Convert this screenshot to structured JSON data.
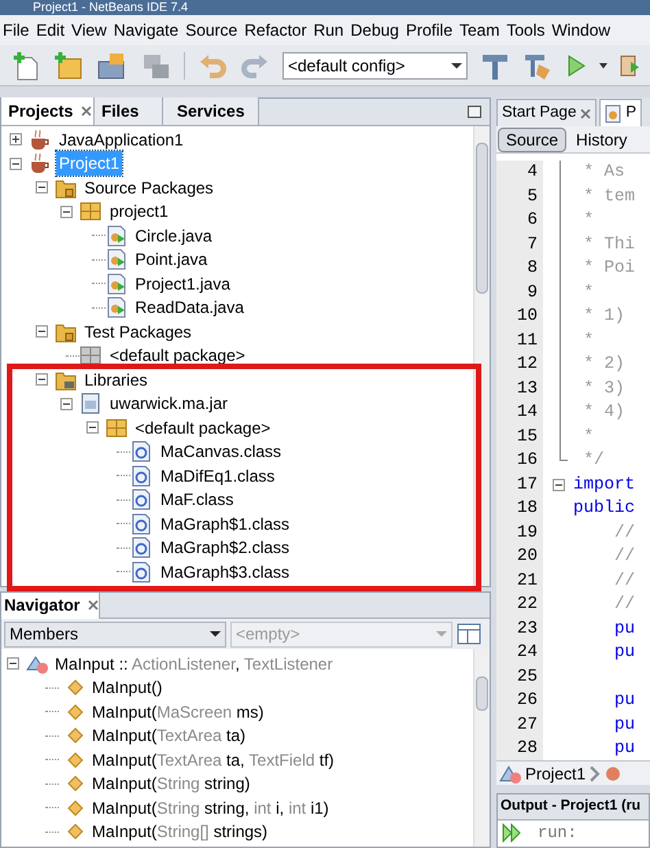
{
  "window": {
    "title": "Project1 - NetBeans IDE 7.4"
  },
  "menu": [
    "File",
    "Edit",
    "View",
    "Navigate",
    "Source",
    "Refactor",
    "Run",
    "Debug",
    "Profile",
    "Team",
    "Tools",
    "Window"
  ],
  "toolbar": {
    "config": "<default config>"
  },
  "projects_panel": {
    "tabs": [
      {
        "label": "Projects",
        "selected": true,
        "closable": true
      },
      {
        "label": "Files",
        "selected": false,
        "closable": false
      },
      {
        "label": "Services",
        "selected": false,
        "closable": false
      }
    ],
    "tree": [
      {
        "label": "JavaApplication1",
        "kind": "project",
        "expanded": false,
        "selected": false
      },
      {
        "label": "Project1",
        "kind": "project",
        "expanded": true,
        "selected": true,
        "children": [
          {
            "label": "Source Packages",
            "kind": "source-folder",
            "expanded": true,
            "selected": false,
            "children": [
              {
                "label": "project1",
                "kind": "package",
                "expanded": true,
                "selected": false,
                "children": [
                  {
                    "label": "Circle.java",
                    "kind": "java",
                    "selected": false
                  },
                  {
                    "label": "Point.java",
                    "kind": "java",
                    "selected": false
                  },
                  {
                    "label": "Project1.java",
                    "kind": "java",
                    "selected": false
                  },
                  {
                    "label": "ReadData.java",
                    "kind": "java",
                    "selected": false
                  }
                ]
              }
            ]
          },
          {
            "label": "Test Packages",
            "kind": "source-folder",
            "expanded": true,
            "selected": false,
            "children": [
              {
                "label": "<default package>",
                "kind": "empty-package",
                "selected": false
              }
            ]
          },
          {
            "label": "Libraries",
            "kind": "libraries",
            "expanded": true,
            "selected": false,
            "children": [
              {
                "label": "uwarwick.ma.jar",
                "kind": "jar",
                "expanded": true,
                "selected": false,
                "children": [
                  {
                    "label": "<default package>",
                    "kind": "package",
                    "expanded": true,
                    "selected": false,
                    "children": [
                      {
                        "label": "MaCanvas.class",
                        "kind": "class",
                        "selected": false
                      },
                      {
                        "label": "MaDifEq1.class",
                        "kind": "class",
                        "selected": false
                      },
                      {
                        "label": "MaF.class",
                        "kind": "class",
                        "selected": false
                      },
                      {
                        "label": "MaGraph$1.class",
                        "kind": "class",
                        "selected": false
                      },
                      {
                        "label": "MaGraph$2.class",
                        "kind": "class",
                        "selected": false
                      },
                      {
                        "label": "MaGraph$3.class",
                        "kind": "class",
                        "selected": false
                      }
                    ]
                  }
                ]
              }
            ]
          }
        ]
      }
    ]
  },
  "navigator": {
    "title": "Navigator",
    "filter": "Members",
    "secondary": "<empty>",
    "root": {
      "parts": [
        {
          "text": "MaInput :: ",
          "kind": "name"
        },
        {
          "text": "ActionListener",
          "kind": "type"
        },
        {
          "text": ", ",
          "kind": "name"
        },
        {
          "text": "TextListener",
          "kind": "type"
        }
      ],
      "expanded": true
    },
    "members": [
      {
        "parts": [
          {
            "text": "MaInput()",
            "kind": "name"
          }
        ]
      },
      {
        "parts": [
          {
            "text": "MaInput(",
            "kind": "name"
          },
          {
            "text": "MaScreen",
            "kind": "type"
          },
          {
            "text": " ms)",
            "kind": "name"
          }
        ]
      },
      {
        "parts": [
          {
            "text": "MaInput(",
            "kind": "name"
          },
          {
            "text": "TextArea",
            "kind": "type"
          },
          {
            "text": " ta)",
            "kind": "name"
          }
        ]
      },
      {
        "parts": [
          {
            "text": "MaInput(",
            "kind": "name"
          },
          {
            "text": "TextArea",
            "kind": "type"
          },
          {
            "text": " ta, ",
            "kind": "name"
          },
          {
            "text": "TextField",
            "kind": "type"
          },
          {
            "text": " tf)",
            "kind": "name"
          }
        ]
      },
      {
        "parts": [
          {
            "text": "MaInput(",
            "kind": "name"
          },
          {
            "text": "String",
            "kind": "type"
          },
          {
            "text": " string)",
            "kind": "name"
          }
        ]
      },
      {
        "parts": [
          {
            "text": "MaInput(",
            "kind": "name"
          },
          {
            "text": "String",
            "kind": "type"
          },
          {
            "text": " string, ",
            "kind": "name"
          },
          {
            "text": "int",
            "kind": "type"
          },
          {
            "text": " i, ",
            "kind": "name"
          },
          {
            "text": "int",
            "kind": "type"
          },
          {
            "text": " i1)",
            "kind": "name"
          }
        ]
      },
      {
        "parts": [
          {
            "text": "MaInput(",
            "kind": "name"
          },
          {
            "text": "String[]",
            "kind": "type"
          },
          {
            "text": " strings)",
            "kind": "name"
          }
        ]
      }
    ]
  },
  "editor": {
    "tabs": [
      {
        "label": "Start Page",
        "selected": false
      },
      {
        "label": "P",
        "selected": true
      }
    ],
    "views": [
      {
        "label": "Source",
        "selected": true
      },
      {
        "label": "History",
        "selected": false
      }
    ],
    "lines": [
      {
        "num": "4",
        "text": " * As",
        "kind": "comment"
      },
      {
        "num": "5",
        "text": " * tem",
        "kind": "comment"
      },
      {
        "num": "6",
        "text": " *",
        "kind": "comment"
      },
      {
        "num": "7",
        "text": " * Thi",
        "kind": "comment"
      },
      {
        "num": "8",
        "text": " * Poi",
        "kind": "comment"
      },
      {
        "num": "9",
        "text": " *",
        "kind": "comment"
      },
      {
        "num": "10",
        "text": " * 1)",
        "kind": "comment"
      },
      {
        "num": "11",
        "text": " *",
        "kind": "comment"
      },
      {
        "num": "12",
        "text": " * 2)",
        "kind": "comment"
      },
      {
        "num": "13",
        "text": " * 3)",
        "kind": "comment"
      },
      {
        "num": "14",
        "text": " * 4)",
        "kind": "comment"
      },
      {
        "num": "15",
        "text": " *",
        "kind": "comment"
      },
      {
        "num": "16",
        "text": " */",
        "kind": "comment-end"
      },
      {
        "num": "17",
        "text": "import",
        "kind": "fold-keyword"
      },
      {
        "num": "18",
        "text": "public",
        "kind": "keyword"
      },
      {
        "num": "19",
        "text": "    //",
        "kind": "comment"
      },
      {
        "num": "20",
        "text": "    //",
        "kind": "comment"
      },
      {
        "num": "21",
        "text": "    //",
        "kind": "comment"
      },
      {
        "num": "22",
        "text": "    //",
        "kind": "comment"
      },
      {
        "num": "23",
        "text": "    pu",
        "kind": "keyword"
      },
      {
        "num": "24",
        "text": "    pu",
        "kind": "keyword"
      },
      {
        "num": "25",
        "kind": "blank"
      },
      {
        "num": "26",
        "text": "    pu",
        "kind": "keyword"
      },
      {
        "num": "27",
        "text": "    pu",
        "kind": "keyword"
      },
      {
        "num": "28",
        "text": "    pu",
        "kind": "keyword"
      }
    ],
    "breadcrumb": "Project1"
  },
  "output": {
    "title": "Output - Project1 (ru",
    "lines": [
      "run:"
    ]
  }
}
